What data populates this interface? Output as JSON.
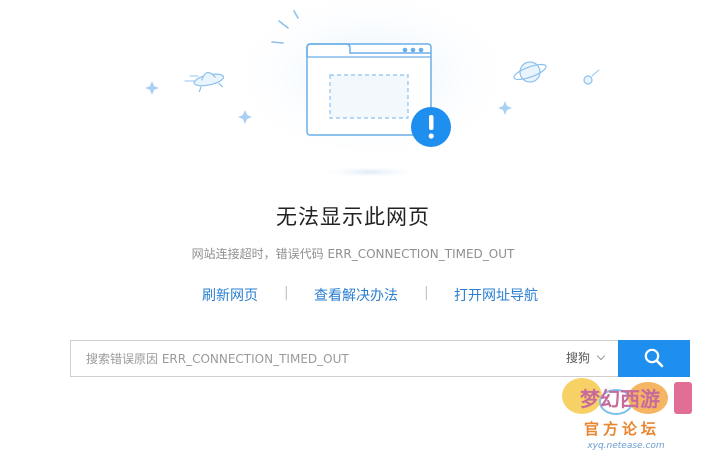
{
  "error": {
    "title": "无法显示此网页",
    "detail": "网站连接超时，错误代码 ERR_CONNECTION_TIMED_OUT"
  },
  "actions": {
    "refresh": "刷新网页",
    "solutions": "查看解决办法",
    "open_nav": "打开网址导航",
    "separator": "|"
  },
  "search": {
    "placeholder": "搜索错误原因 ERR_CONNECTION_TIMED_OUT",
    "engine": "搜狗",
    "button_icon": "search-icon"
  },
  "illustration": {
    "icons": [
      "ufo-icon",
      "planet-icon",
      "comet-icon",
      "sparkle-icon",
      "browser-window-icon",
      "exclamation-icon"
    ]
  },
  "watermark": {
    "logo_text": "梦幻西游",
    "caption": "官方论坛",
    "url": "xyq.netease.com"
  },
  "colors": {
    "accent": "#1e8fef",
    "link": "#2a7fd0",
    "illustration_stroke": "#6aaee8",
    "illustration_fill": "#eef6fd"
  }
}
